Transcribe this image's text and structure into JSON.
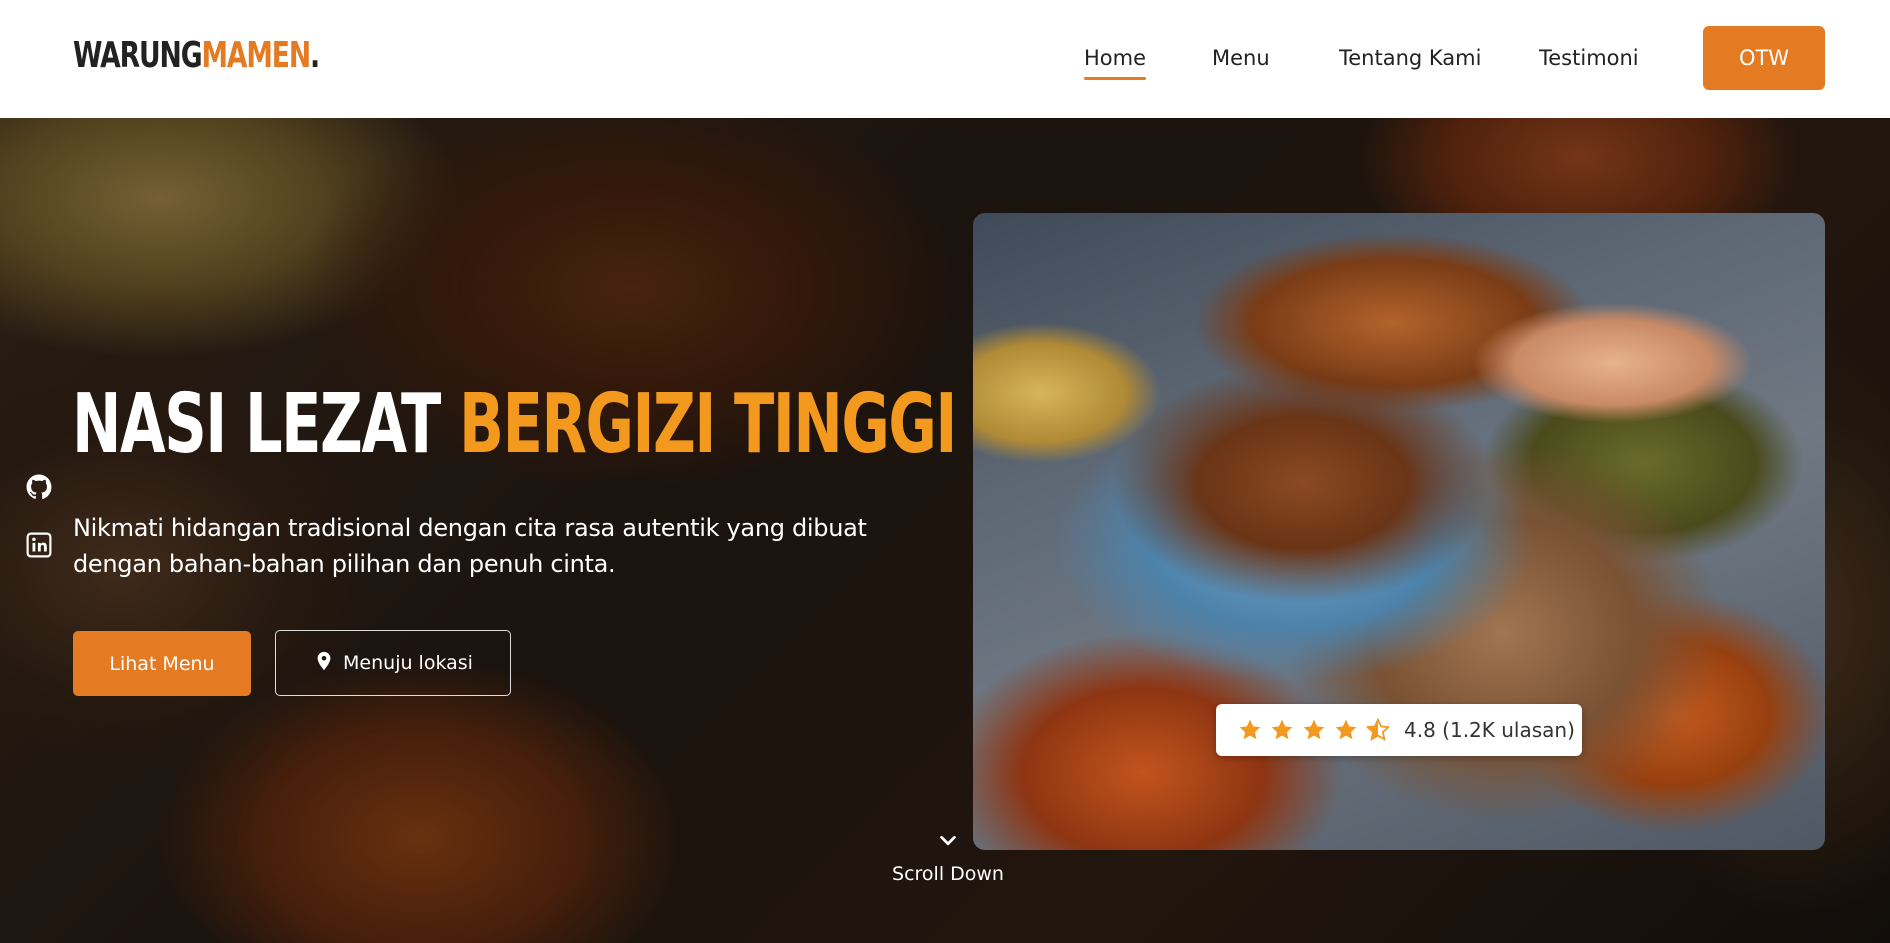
{
  "brand": {
    "part1": "WARUNG",
    "part2": "MAMEN",
    "part3": "."
  },
  "nav": {
    "items": [
      {
        "label": "Home",
        "active": true
      },
      {
        "label": "Menu",
        "active": false
      },
      {
        "label": "Tentang Kami",
        "active": false
      },
      {
        "label": "Testimoni",
        "active": false
      }
    ],
    "cta_label": "OTW"
  },
  "hero": {
    "title_white": "NASI LEZAT",
    "title_orange": "BERGIZI TINGGI",
    "subtitle": "Nikmati hidangan tradisional dengan cita rasa autentik yang dibuat dengan bahan-bahan pilihan dan penuh cinta.",
    "primary_button": "Lihat Menu",
    "secondary_button": "Menuju lokasi",
    "scroll_label": "Scroll Down"
  },
  "social": {
    "icons": [
      "github-icon",
      "linkedin-icon"
    ]
  },
  "rating": {
    "stars": 4.5,
    "text": "4.8 (1.2K ulasan)"
  },
  "colors": {
    "accent": "#e47b22",
    "title_accent": "#f39a1e",
    "star": "#f39a1e",
    "dark_text": "#222222"
  }
}
